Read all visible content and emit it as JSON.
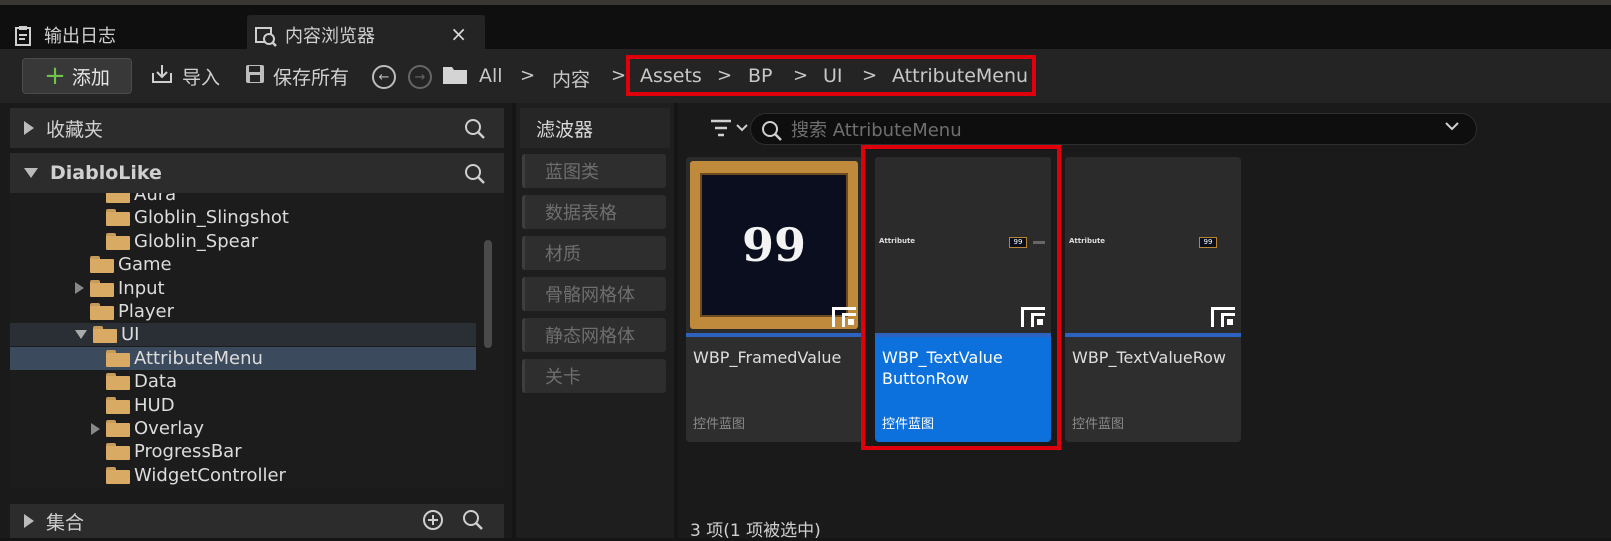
{
  "tabs": [
    {
      "label": "输出日志",
      "icon": "log-icon"
    },
    {
      "label": "内容浏览器",
      "icon": "content-browser-icon",
      "close": "×"
    }
  ],
  "toolbar": {
    "add_label": "添加",
    "import_label": "导入",
    "save_all_label": "保存所有",
    "breadcrumbs": [
      "All",
      "内容",
      "Assets",
      "BP",
      "UI",
      "AttributeMenu"
    ],
    "separator": ">"
  },
  "sidebar": {
    "favorites_label": "收藏夹",
    "project_label": "DiabloLike",
    "collections_label": "集合",
    "tree": [
      {
        "label": "Aura",
        "depth": 3,
        "expander": "none"
      },
      {
        "label": "Globlin_Slingshot",
        "depth": 3,
        "expander": "none"
      },
      {
        "label": "Globlin_Spear",
        "depth": 3,
        "expander": "none"
      },
      {
        "label": "Game",
        "depth": 2,
        "expander": "none"
      },
      {
        "label": "Input",
        "depth": 2,
        "expander": "collapsed"
      },
      {
        "label": "Player",
        "depth": 2,
        "expander": "none"
      },
      {
        "label": "UI",
        "depth": 2,
        "expander": "expanded"
      },
      {
        "label": "AttributeMenu",
        "depth": 3,
        "expander": "none",
        "selected": true
      },
      {
        "label": "Data",
        "depth": 3,
        "expander": "none"
      },
      {
        "label": "HUD",
        "depth": 3,
        "expander": "none"
      },
      {
        "label": "Overlay",
        "depth": 3,
        "expander": "collapsed"
      },
      {
        "label": "ProgressBar",
        "depth": 3,
        "expander": "none"
      },
      {
        "label": "WidgetController",
        "depth": 3,
        "expander": "none"
      }
    ]
  },
  "filters": {
    "header": "滤波器",
    "items": [
      "蓝图类",
      "数据表格",
      "材质",
      "骨骼网格体",
      "静态网格体",
      "关卡"
    ]
  },
  "search": {
    "placeholder": "搜索 AttributeMenu"
  },
  "assets": [
    {
      "name": "WBP_FramedValue",
      "type": "控件蓝图",
      "thumb_value": "99",
      "selected": false
    },
    {
      "name": "WBP_TextValue ButtonRow",
      "type": "控件蓝图",
      "thumb_label": "Attribute",
      "thumb_value": "99",
      "selected": true
    },
    {
      "name": "WBP_TextValueRow",
      "type": "控件蓝图",
      "thumb_label": "Attribute",
      "thumb_value": "99",
      "selected": false
    }
  ],
  "status_text": "3 项(1 项被选中)",
  "colors": {
    "highlight": "#e0000b",
    "selected": "#0c70dd",
    "folder": "#d9aa63",
    "add_plus": "#6fc24a"
  }
}
